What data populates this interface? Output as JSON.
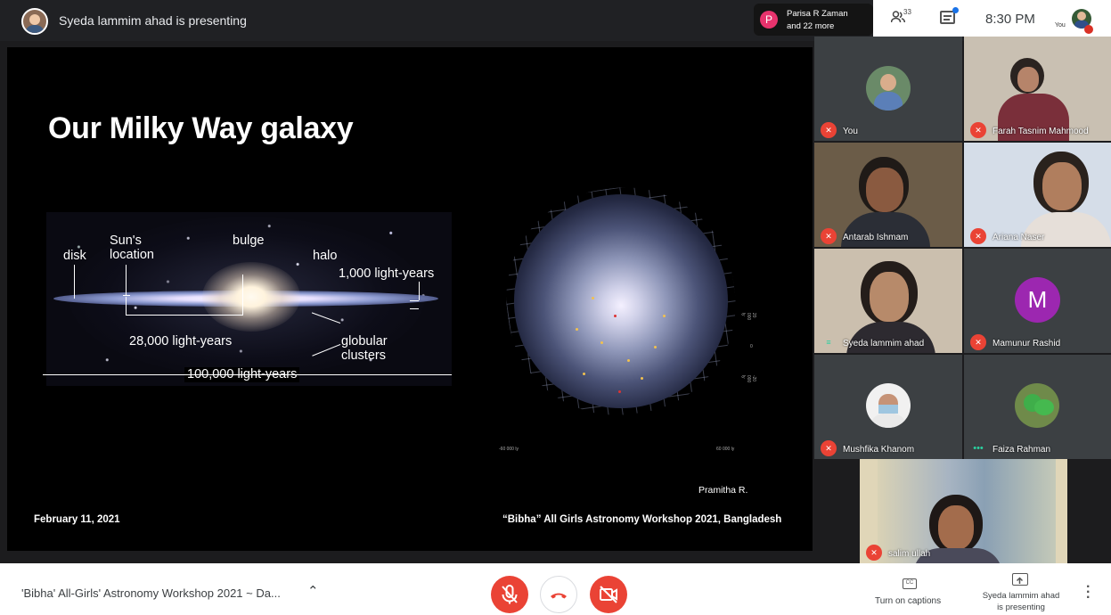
{
  "presenting": {
    "text": "Syeda lammim ahad is presenting"
  },
  "joined": {
    "initial": "P",
    "line1": "Parisa R Zaman",
    "line2": "and 22 more"
  },
  "toolbar": {
    "people_count": "33",
    "time": "8:30 PM",
    "you_label": "You"
  },
  "slide": {
    "title": "Our Milky Way galaxy",
    "labels": {
      "disk": "disk",
      "suns_location": "Sun's\nlocation",
      "bulge": "bulge",
      "halo": "halo",
      "ly1000": "1,000 light-years",
      "ly28000": "28,000 light-years",
      "globular": "globular\nclusters",
      "ly100000": "100,000 light-years"
    },
    "face_ticks": {
      "left": "-60 000 ly",
      "right": "60 000 ly",
      "top": "20 000 ly",
      "zero": "0",
      "bottom": "-20 000 ly"
    },
    "credit": "Pramitha R.",
    "date": "February 11, 2021",
    "footer": "“Bibha” All Girls Astronomy Workshop 2021, Bangladesh"
  },
  "participants": [
    {
      "name": "You"
    },
    {
      "name": "Farah Tasnim Mahmood"
    },
    {
      "name": "Antarab Ishmam"
    },
    {
      "name": "Ariana Naser"
    },
    {
      "name": "Syeda lammim ahad"
    },
    {
      "name": "Mamunur Rashid",
      "initial": "M"
    },
    {
      "name": "Mushfika Khanom"
    },
    {
      "name": "Faiza Rahman"
    },
    {
      "name": "salim ullah"
    }
  ],
  "bottom": {
    "meeting_title": "'Bibha' All-Girls' Astronomy Workshop 2021 ~ Da...",
    "captions": "Turn on captions",
    "presenting_line1": "Syeda lammim ahad",
    "presenting_line2": "is presenting"
  },
  "colors": {
    "end_call": "#ea4335",
    "accent": "#1a73e8"
  }
}
